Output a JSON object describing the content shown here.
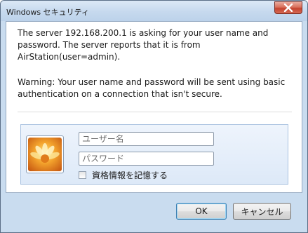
{
  "window": {
    "title": "Windows セキュリティ",
    "close_icon": "close-x-icon"
  },
  "message": {
    "line1": "The server 192.168.200.1 is asking for your user name and password. The server reports that it is from AirStation(user=admin).",
    "line2": "Warning: Your user name and password will be sent using basic authentication on a connection that isn't secure."
  },
  "credentials": {
    "avatar_icon": "user-tile-flower-icon",
    "username_placeholder": "ユーザー名",
    "username_value": "",
    "password_placeholder": "パスワード",
    "password_value": "",
    "remember_label": "資格情報を記憶する",
    "remember_checked": false
  },
  "buttons": {
    "ok_label": "OK",
    "cancel_label": "キャンセル"
  },
  "colors": {
    "window_frame": "#c9dcef",
    "close_button": "#c4432f",
    "panel": "#dde9f8"
  }
}
